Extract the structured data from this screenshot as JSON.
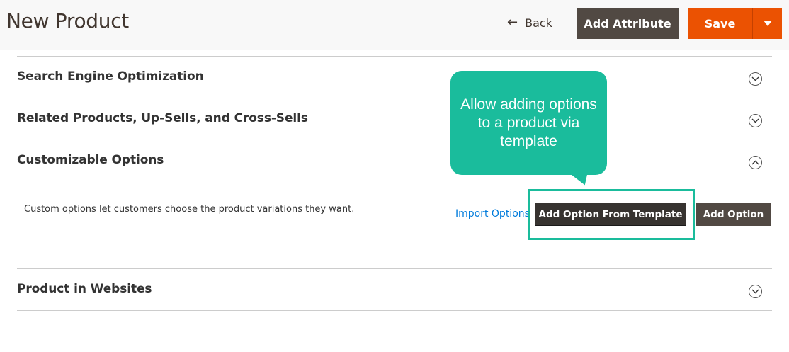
{
  "header": {
    "title": "New Product",
    "back_label": "Back",
    "add_attribute_label": "Add Attribute",
    "save_label": "Save"
  },
  "sections": {
    "seo": {
      "title": "Search Engine Optimization",
      "state": "collapsed"
    },
    "related": {
      "title": "Related Products, Up-Sells, and Cross-Sells",
      "state": "collapsed"
    },
    "custom_options": {
      "title": "Customizable Options",
      "state": "expanded",
      "description": "Custom options let customers choose the product variations they want.",
      "import_label": "Import Options",
      "template_button_label": "Add Option From Template",
      "add_option_label": "Add Option"
    },
    "websites": {
      "title": "Product in Websites",
      "state": "collapsed"
    }
  },
  "callout": {
    "text": "Allow adding options to a product via template"
  },
  "colors": {
    "accent_orange": "#eb5202",
    "dark_button": "#514943",
    "highlight_teal": "#1abc9c",
    "link_blue": "#007bdb"
  },
  "icons": {
    "back": "arrow-left-icon",
    "save_menu": "caret-down-icon",
    "collapsed": "chevron-down-circle-icon",
    "expanded": "chevron-up-circle-icon"
  }
}
